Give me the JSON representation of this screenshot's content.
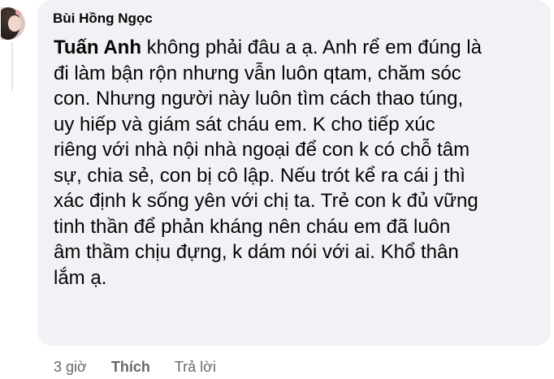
{
  "comment": {
    "author": "Bùi Hồng Ngọc",
    "mention": "Tuấn Anh",
    "lines": [
      " không phải đâu a ạ. Anh rể em đúng là",
      "đi làm bận rộn nhưng vẫn luôn qtam, chăm sóc",
      "con. Nhưng người này luôn tìm cách thao túng,",
      "uy hiếp và giám sát cháu em. K cho tiếp xúc",
      "riêng với nhà nội nhà ngoại để con k có chỗ tâm",
      "sự, chia sẻ, con bị cô lập. Nếu trót kể ra cái j thì",
      "xác định k sống yên với chị ta. Trẻ con k đủ vững",
      "tinh thần để phản kháng nên cháu em đã luôn",
      "âm thầm chịu đựng, k dám nói với ai. Khổ thân",
      "lắm ạ."
    ]
  },
  "meta": {
    "time": "3 giờ",
    "like_label": "Thích",
    "reply_label": "Trả lời"
  },
  "colors": {
    "bubble": "#f0f2f5",
    "text": "#050505",
    "secondary": "#65676b"
  }
}
